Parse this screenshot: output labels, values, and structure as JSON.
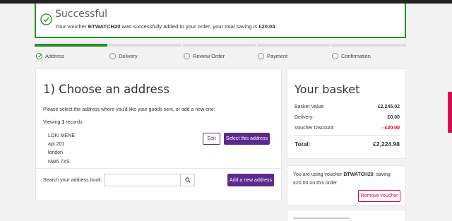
{
  "alert": {
    "title": "Successful",
    "msg_prefix": "Your voucher ",
    "voucher_code": "BTWATCH20",
    "msg_middle": " was successfully added to your order, your total saving is ",
    "saving": "£20.04"
  },
  "progress": {
    "completed_fraction": 0.2,
    "steps": [
      {
        "label": "Address",
        "state": "done"
      },
      {
        "label": "Delivery",
        "state": "pending"
      },
      {
        "label": "Review Order",
        "state": "pending"
      },
      {
        "label": "Payment",
        "state": "pending"
      },
      {
        "label": "Confirmation",
        "state": "pending"
      }
    ]
  },
  "address": {
    "heading": "1) Choose an address",
    "intro": "Please select the address where you'd like your goods sent, or add a new one:",
    "viewing_prefix": "Viewing ",
    "viewing_count": "1",
    "viewing_suffix": " records",
    "lines": [
      "LOKI MENE",
      "apt 201",
      "london",
      "NW6 7XS"
    ],
    "edit_label": "Edit",
    "select_label": "Select this address",
    "search_label": "Search your address book:",
    "search_placeholder": "",
    "add_label": "Add a new address"
  },
  "basket": {
    "heading": "Your basket",
    "rows": [
      {
        "label": "Basket Value:",
        "value": "£2,245.02"
      },
      {
        "label": "Delivery:",
        "value": "£0.00"
      },
      {
        "label": "Voucher Discount:",
        "value": "- £20.00"
      }
    ],
    "total_label": "Total:",
    "total_value": "£2,224.98"
  },
  "voucher": {
    "text_prefix": "You are using voucher ",
    "code": "BTWATCH20",
    "text_suffix": ", saving £20.00 on this order.",
    "remove_label": "Remove voucher"
  },
  "colors": {
    "success": "#2e8b2e",
    "brand_purple": "#5b2a8c",
    "brand_pink": "#e60050",
    "discount_red": "#d0021b"
  }
}
